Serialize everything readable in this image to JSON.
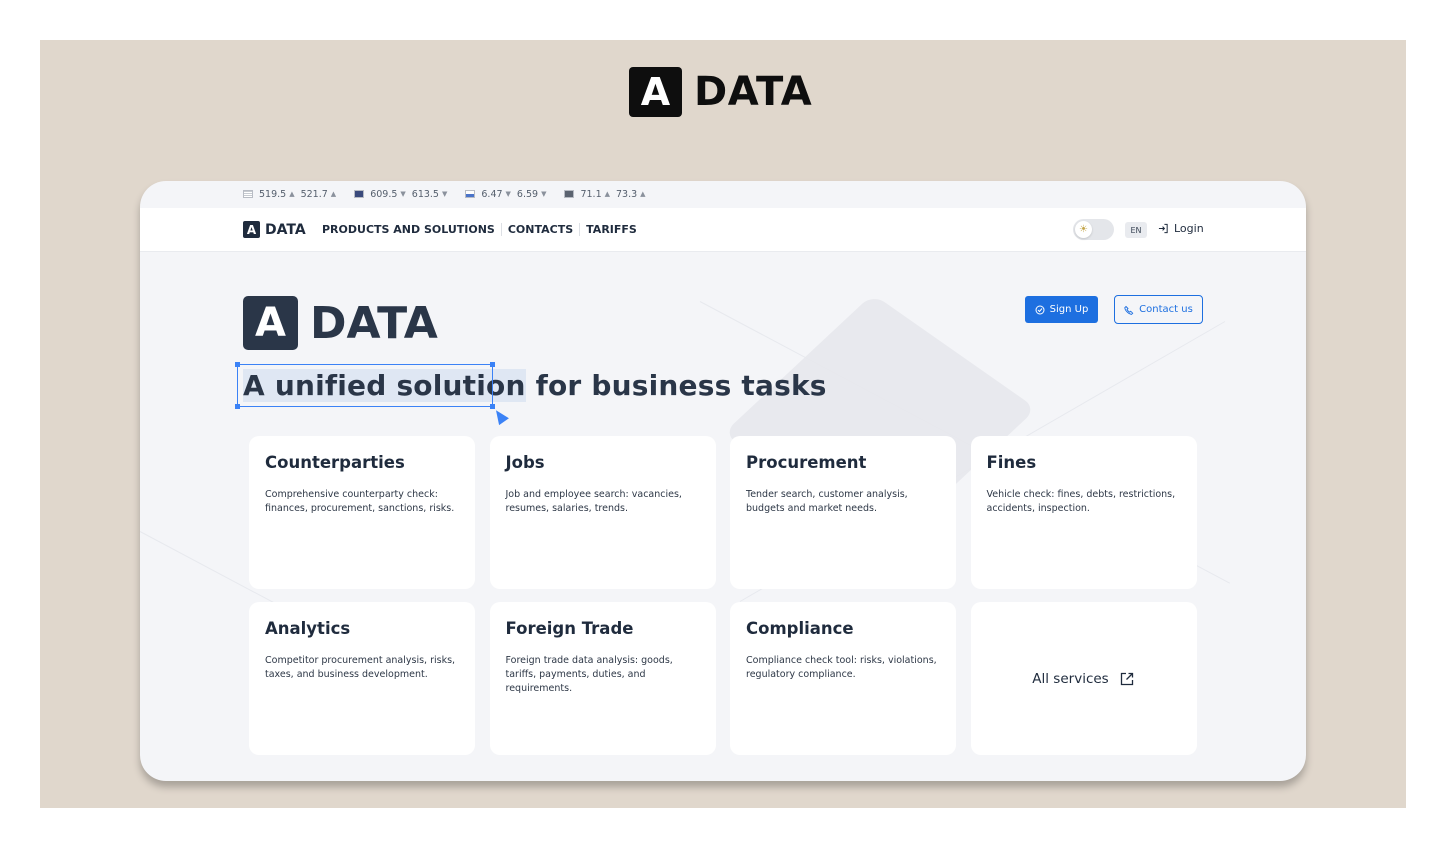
{
  "brand": {
    "letter": "A",
    "word": "DATA"
  },
  "ticker": [
    {
      "flag": "us",
      "v1": "519.5",
      "d1": "up",
      "v2": "521.7",
      "d2": "up"
    },
    {
      "flag": "eu",
      "v1": "609.5",
      "d1": "down",
      "v2": "613.5",
      "d2": "down"
    },
    {
      "flag": "cn",
      "v1": "6.47",
      "d1": "down",
      "v2": "6.59",
      "d2": "down"
    },
    {
      "flag": "oil",
      "v1": "71.1",
      "d1": "up",
      "v2": "73.3",
      "d2": "up"
    }
  ],
  "nav": {
    "items": [
      "PRODUCTS AND SOLUTIONS",
      "CONTACTS",
      "TARIFFS"
    ],
    "lang": "EN",
    "login": "Login",
    "theme_icon": "sun-icon"
  },
  "hero": {
    "signup": "Sign Up",
    "contact": "Contact us",
    "headline_selected": "A unified solution",
    "headline_rest": " for business tasks"
  },
  "cards": [
    {
      "title": "Counterparties",
      "desc": "Comprehensive counterparty check: finances, procurement, sanctions, risks."
    },
    {
      "title": "Jobs",
      "desc": "Job and employee search: vacancies, resumes, salaries, trends."
    },
    {
      "title": "Procurement",
      "desc": "Tender search, customer analysis, budgets and market needs."
    },
    {
      "title": "Fines",
      "desc": "Vehicle check: fines, debts, restrictions, accidents, inspection."
    },
    {
      "title": "Analytics",
      "desc": "Competitor procurement analysis, risks, taxes, and business development."
    },
    {
      "title": "Foreign Trade",
      "desc": "Foreign trade data analysis: goods, tariffs, payments, duties, and requirements."
    },
    {
      "title": "Compliance",
      "desc": "Compliance check tool: risks, violations, regulatory compliance."
    }
  ],
  "all_services": "All services",
  "colors": {
    "primary": "#1d6fe0",
    "dark": "#2a3648",
    "frame": "#e0d7cc"
  }
}
